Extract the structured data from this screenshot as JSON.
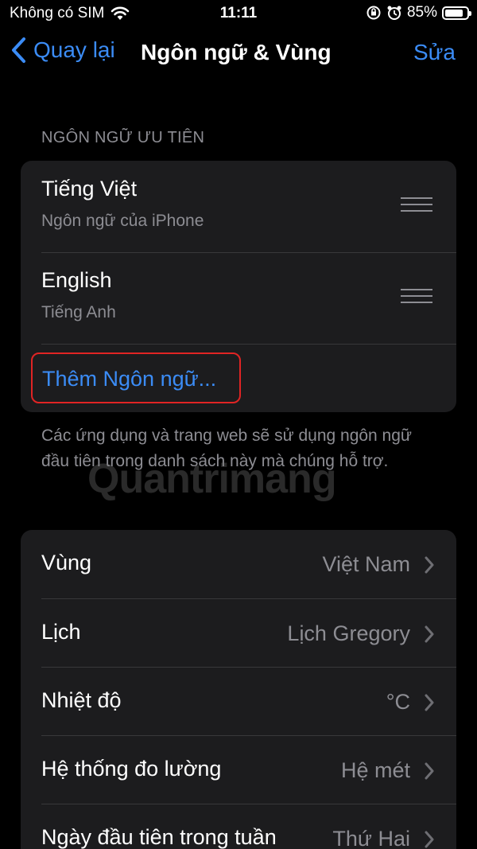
{
  "status_bar": {
    "carrier": "Không có SIM",
    "time": "11:11",
    "battery_percent": "85%",
    "battery_level": 0.85
  },
  "nav": {
    "back_label": "Quay lại",
    "title": "Ngôn ngữ & Vùng",
    "edit_label": "Sửa"
  },
  "preferred_languages": {
    "header": "NGÔN NGỮ ƯU TIÊN",
    "items": [
      {
        "title": "Tiếng Việt",
        "subtitle": "Ngôn ngữ của iPhone"
      },
      {
        "title": "English",
        "subtitle": "Tiếng Anh"
      }
    ],
    "add_label": "Thêm Ngôn ngữ...",
    "footnote": "Các ứng dụng và trang web sẽ sử dụng ngôn ngữ đầu tiên trong danh sách này mà chúng hỗ trợ."
  },
  "watermark": "Quantrimang",
  "region_settings": [
    {
      "label": "Vùng",
      "value": "Việt Nam"
    },
    {
      "label": "Lịch",
      "value": "Lịch Gregory"
    },
    {
      "label": "Nhiệt độ",
      "value": "°C"
    },
    {
      "label": "Hệ thống đo lường",
      "value": "Hệ mét"
    },
    {
      "label": "Ngày đầu tiên trong tuần",
      "value": "Thứ Hai"
    }
  ],
  "colors": {
    "accent": "#3b8cf6",
    "highlight_box": "#e02424",
    "secondary_text": "#8d8d93",
    "cell_background": "#1c1c1e"
  }
}
